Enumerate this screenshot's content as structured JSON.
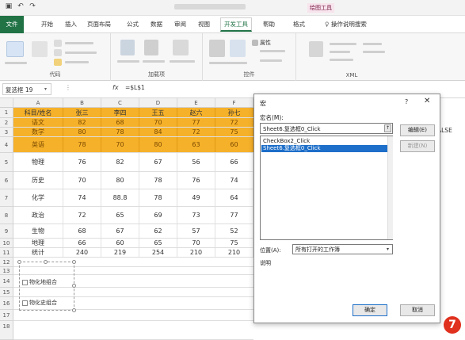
{
  "titlebar": {
    "context_tab": "绘图工具"
  },
  "ribbon_tabs": [
    "文件",
    "开始",
    "插入",
    "页面布局",
    "公式",
    "数据",
    "审阅",
    "视图",
    "开发工具",
    "帮助",
    "格式",
    "操作说明搜索"
  ],
  "ribbon_groups": [
    "代码",
    "加载项",
    "控件",
    "XML"
  ],
  "ribbon_controls": [
    "属性"
  ],
  "formula_bar": {
    "name_box": "复选框 19",
    "formula": "=$L$1"
  },
  "columns": [
    "A",
    "B",
    "C",
    "D",
    "E",
    "F"
  ],
  "far_column": "O",
  "far_cell_text": "ALSE",
  "table": {
    "header": [
      "科目/姓名",
      "张三",
      "李四",
      "王五",
      "赵六",
      "孙七"
    ],
    "rows": [
      {
        "n": "2",
        "cells": [
          "语文",
          "82",
          "68",
          "70",
          "77",
          "72"
        ],
        "hl": true
      },
      {
        "n": "3",
        "cells": [
          "数学",
          "80",
          "78",
          "84",
          "72",
          "75"
        ],
        "hl": true
      },
      {
        "n": "4",
        "cells": [
          "英语",
          "78",
          "70",
          "80",
          "63",
          "60"
        ],
        "hl": true
      },
      {
        "n": "5",
        "cells": [
          "物理",
          "76",
          "82",
          "67",
          "56",
          "66"
        ],
        "hl": false
      },
      {
        "n": "6",
        "cells": [
          "历史",
          "70",
          "80",
          "78",
          "76",
          "74"
        ],
        "hl": false
      },
      {
        "n": "7",
        "cells": [
          "化学",
          "74",
          "88.8",
          "78",
          "49",
          "64"
        ],
        "hl": false
      },
      {
        "n": "8",
        "cells": [
          "政治",
          "72",
          "65",
          "69",
          "73",
          "77"
        ],
        "hl": false
      },
      {
        "n": "9",
        "cells": [
          "生物",
          "68",
          "67",
          "62",
          "57",
          "52"
        ],
        "hl": false
      },
      {
        "n": "10",
        "cells": [
          "地理",
          "66",
          "60",
          "65",
          "70",
          "75"
        ],
        "hl": false
      },
      {
        "n": "11",
        "cells": [
          "统计",
          "240",
          "219",
          "254",
          "210",
          "210"
        ],
        "hl": false
      }
    ],
    "extra_rows": [
      "12",
      "13",
      "14",
      "15",
      "16",
      "17",
      "18"
    ]
  },
  "sheet_controls": {
    "checkbox1": "物化地组合",
    "checkbox2": "物化史组合"
  },
  "dialog": {
    "title": "宏",
    "name_label": "宏名(M):",
    "name_value": "Sheet6.复选框0_Click",
    "list": [
      "CheckBox2_Click",
      "Sheet6.复选框0_Click"
    ],
    "selected_index": 1,
    "buttons": {
      "edit": "编辑(E)",
      "new": "新建(N)",
      "ok": "确定",
      "cancel": "取消"
    },
    "location_label": "位置(A):",
    "location_value": "所有打开的工作簿",
    "description_label": "说明"
  },
  "badge": "7",
  "colors": {
    "highlight": "#f6b12a",
    "excel_green": "#217346",
    "selection_blue": "#1e6fc9",
    "badge_red": "#e0301e"
  }
}
